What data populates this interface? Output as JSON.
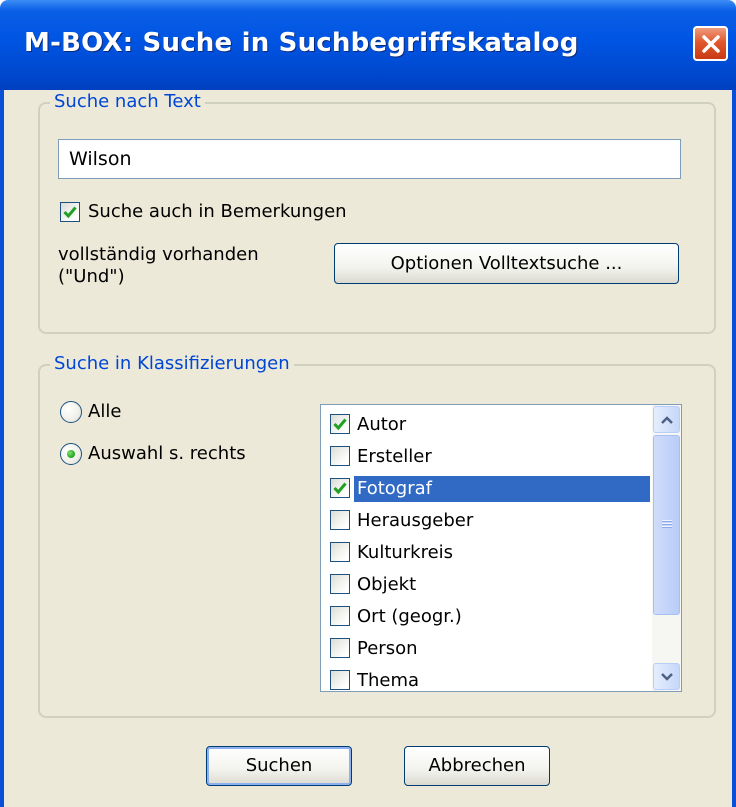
{
  "window": {
    "title": "M-BOX: Suche in Suchbegriffskatalog",
    "close_icon": "close-x-icon"
  },
  "text_search": {
    "legend": "Suche nach Text",
    "input_value": "Wilson",
    "also_remarks_label": "Suche auch in Bemerkungen",
    "also_remarks_checked": true,
    "mode_line1": "vollständig vorhanden",
    "mode_line2": "(\"Und\")",
    "options_button": "Optionen Volltextsuche ..."
  },
  "classifications": {
    "legend": "Suche in Klassifizierungen",
    "radio_all": "Alle",
    "radio_selection": "Auswahl s. rechts",
    "selected_radio": "selection",
    "items": [
      {
        "label": "Autor",
        "checked": true,
        "selected": false
      },
      {
        "label": "Ersteller",
        "checked": false,
        "selected": false
      },
      {
        "label": "Fotograf",
        "checked": true,
        "selected": true
      },
      {
        "label": "Herausgeber",
        "checked": false,
        "selected": false
      },
      {
        "label": "Kulturkreis",
        "checked": false,
        "selected": false
      },
      {
        "label": "Objekt",
        "checked": false,
        "selected": false
      },
      {
        "label": "Ort (geogr.)",
        "checked": false,
        "selected": false
      },
      {
        "label": "Person",
        "checked": false,
        "selected": false
      },
      {
        "label": "Thema",
        "checked": false,
        "selected": false
      }
    ]
  },
  "footer": {
    "search_button": "Suchen",
    "cancel_button": "Abbrechen"
  },
  "colors": {
    "titlebar": "#0054e3",
    "dialog_bg": "#ece9d8",
    "legend_text": "#0046d5",
    "selection": "#316ac5",
    "checkmark": "#21a121"
  }
}
